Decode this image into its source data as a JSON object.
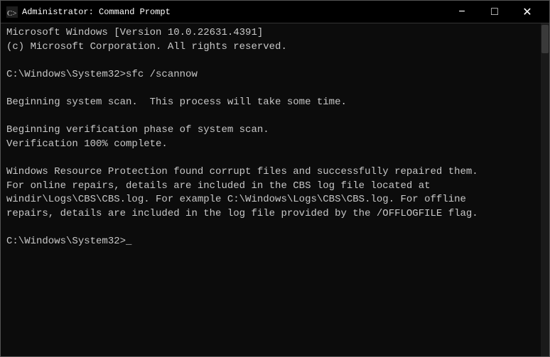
{
  "titlebar": {
    "icon": "cmd-icon",
    "title": "Administrator: Command Prompt",
    "minimize_label": "−",
    "maximize_label": "□",
    "close_label": "✕"
  },
  "terminal": {
    "content": "Microsoft Windows [Version 10.0.22631.4391]\n(c) Microsoft Corporation. All rights reserved.\n\nC:\\Windows\\System32>sfc /scannow\n\nBeginning system scan.  This process will take some time.\n\nBeginning verification phase of system scan.\nVerification 100% complete.\n\nWindows Resource Protection found corrupt files and successfully repaired them.\nFor online repairs, details are included in the CBS log file located at\nwindir\\Logs\\CBS\\CBS.log. For example C:\\Windows\\Logs\\CBS\\CBS.log. For offline\nrepairs, details are included in the log file provided by the /OFFLOGFILE flag.\n\nC:\\Windows\\System32>_"
  }
}
